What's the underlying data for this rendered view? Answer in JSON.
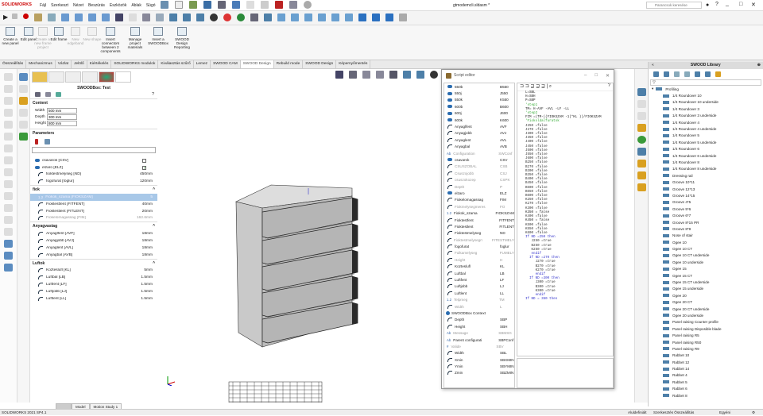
{
  "app": {
    "logo": "SOLIDWORKS",
    "title": "gtmodemcli.sldasm *",
    "search_placeholder": "Parancsok keresése"
  },
  "menu": [
    "Fájl",
    "Szerkeszt",
    "Nézet",
    "Beszúrás",
    "Eszközök",
    "Ablak",
    "Súgó"
  ],
  "ribbon": [
    {
      "label": "Create a new panel",
      "disabled": false
    },
    {
      "label": "Edit panel",
      "disabled": false
    },
    {
      "label": "Create a new frame project",
      "disabled": true
    },
    {
      "label": "Edit frame",
      "disabled": false
    },
    {
      "label": "New edgeband",
      "disabled": true
    },
    {
      "label": "New shape",
      "disabled": true
    },
    {
      "label": "Insert connectors between 2 components",
      "disabled": false
    },
    {
      "label": "Manage project materials",
      "disabled": false
    },
    {
      "label": "Insert a SWOODBox",
      "disabled": false
    },
    {
      "label": "SWOOD Design Reporting",
      "disabled": false
    }
  ],
  "tabs": [
    "Összeállítás",
    "Mechanizmus",
    "Vázlat",
    "Jelölő",
    "Kiértékelés",
    "SOLIDWORKS modulok",
    "Kiválasztás szűrő",
    "Lemez",
    "SWOOD CAM",
    "SWOOD Design",
    "Rebuild mode",
    "SWOOD Design",
    "Képernyőmentés"
  ],
  "active_tab": 9,
  "panel": {
    "title": "SWOODBox: Test",
    "content_label": "Content",
    "fields": [
      {
        "label": "Width",
        "value": "500 mm"
      },
      {
        "label": "Depth",
        "value": "300 mm"
      },
      {
        "label": "Height",
        "value": "800 mm"
      }
    ],
    "parameters_label": "Parameters",
    "params": [
      {
        "label": "csavarok [CSV]",
        "value": "",
        "type": "check",
        "checked": false
      },
      {
        "label": "elzaro [ELZ]",
        "value": "",
        "type": "check",
        "checked": true
      },
      {
        "label": "fioktestmelyseg [ND]",
        "value": "450mm",
        "type": "dim"
      },
      {
        "label": "fogofurat [foglur]",
        "value": "120mm",
        "type": "dim"
      }
    ],
    "groups": [
      {
        "name": "fiok",
        "rows": [
          {
            "label": "Fiokok_szama [FIOKSZAM]",
            "value": "5",
            "sel": true,
            "type": "num"
          },
          {
            "label": "Fioktestfent [FITFENT]",
            "value": "40mm"
          },
          {
            "label": "Fioktestlent [FITLENT]",
            "value": "20mm"
          },
          {
            "label": "Fiokelomagassag [FIM]",
            "value": "162.6mm",
            "grey": true
          }
        ]
      },
      {
        "name": "Anyagvastag",
        "rows": [
          {
            "label": "Anyaglfent [AVF]",
            "value": "18mm"
          },
          {
            "label": "Anyagjobb [AVJ]",
            "value": "18mm"
          },
          {
            "label": "Anyaglent [AVL]",
            "value": "18mm"
          },
          {
            "label": "Anyagbal [AVB]",
            "value": "18mm"
          }
        ]
      },
      {
        "name": "Luftok",
        "rows": [
          {
            "label": "Kozteslufl [KL]",
            "value": "5mm"
          },
          {
            "label": "Luftbal [LB]",
            "value": "1.5mm"
          },
          {
            "label": "Luftfent [LF]",
            "value": "1.5mm"
          },
          {
            "label": "Luftjobb [LJ]",
            "value": "1.5mm"
          },
          {
            "label": "Luftlent [LL]",
            "value": "1.5mm"
          }
        ]
      }
    ]
  },
  "script_editor": {
    "title": "Script editor",
    "vars": [
      [
        "550b",
        "B550",
        0,
        "t"
      ],
      [
        "550j",
        "J550",
        0,
        "t"
      ],
      [
        "550k",
        "K550",
        0,
        "t"
      ],
      [
        "600b",
        "B600",
        0,
        "t"
      ],
      [
        "600j",
        "J600",
        0,
        "t"
      ],
      [
        "600k",
        "K600",
        0,
        "t"
      ],
      [
        "Anyaglfent",
        "AVF",
        0,
        "d"
      ],
      [
        "Anyagjobb",
        "AVJ",
        0,
        "d"
      ],
      [
        "Anyaglent",
        "AVL",
        0,
        "d"
      ],
      [
        "Anyagbal",
        "AVB",
        0,
        "d"
      ],
      [
        "Configuration",
        "SWConf",
        1,
        "a"
      ],
      [
        "csavarok",
        "CSV",
        0,
        "t"
      ],
      [
        "CSUSZOBAL",
        "CSB",
        1,
        "d"
      ],
      [
        "Csuszojobb",
        "CSJ",
        1,
        "d"
      ],
      [
        "csuszokozep",
        "CSPK",
        1,
        "d"
      ],
      [
        "Depth",
        "P",
        1,
        "d"
      ],
      [
        "elzaro",
        "ELZ",
        0,
        "t"
      ],
      [
        "Fiokelomagassag",
        "FIM",
        0,
        "d"
      ],
      [
        "Fiokmelysegmeres",
        "FO",
        1,
        "d"
      ],
      [
        "Fiokok_szama",
        "FIOKSZAM",
        0,
        "n"
      ],
      [
        "Fioktestfent",
        "FITFENT",
        0,
        "d"
      ],
      [
        "Fioktestlent",
        "FITLENT",
        0,
        "d"
      ],
      [
        "Fioktestmelyseg",
        "ND",
        0,
        "d"
      ],
      [
        "Fioktestmelysegmeres",
        "FITESTMELY",
        1,
        "d"
      ],
      [
        "fogofurat",
        "foglur",
        0,
        "d"
      ],
      [
        "Fulkamelyseg",
        "FUMELY",
        1,
        "d"
      ],
      [
        "Height",
        "H",
        1,
        "d"
      ],
      [
        "Kozteslufl",
        "KL",
        0,
        "d"
      ],
      [
        "Luftbal",
        "LB",
        0,
        "d"
      ],
      [
        "Luftfent",
        "LF",
        0,
        "d"
      ],
      [
        "Luftjobb",
        "LJ",
        0,
        "d"
      ],
      [
        "Luftlent",
        "LL",
        0,
        "d"
      ],
      [
        "Telpmeg",
        "TM",
        1,
        "n"
      ],
      [
        "Width",
        "L",
        1,
        "d"
      ],
      [
        "SWOODBox Context",
        "",
        0,
        "g"
      ],
      [
        "Depth",
        "SBP",
        0,
        "d"
      ],
      [
        "Height",
        "SBH",
        0,
        "d"
      ],
      [
        "Message",
        "SBMSG",
        1,
        "a"
      ],
      [
        "Parent configurati",
        "SBPConf",
        0,
        "a"
      ],
      [
        "Valide",
        "SBV",
        1,
        "h"
      ],
      [
        "Width",
        "SBL",
        0,
        "d"
      ],
      [
        "Xmin",
        "SBXMIN",
        0,
        "d"
      ],
      [
        "Ymin",
        "SBYMIN",
        0,
        "d"
      ],
      [
        "Zmin",
        "SBZMIN",
        0,
        "d"
      ]
    ],
    "code": [
      "L=SBL",
      "H=SBH",
      "P=SBP",
      "",
      "'step1",
      "",
      "TM= H-AVF -AVL -LF -LL",
      "",
      "'step2",
      "",
      "FIM =(TM-((FIOKSZAM -1)*KL ))/FIOKSZAM",
      "",
      "'Fiokoldalfuratok",
      "",
      "J250 =false",
      "J270 =false",
      "J300 =false",
      "J350 =false",
      "J400 =false",
      "J450 =false",
      "J500 =false",
      "J550 =false",
      "J600 =false",
      "B250 =false",
      "B270 =false",
      "B300 =false",
      "B350 =false",
      "B400 =false",
      "B450 =false",
      "B500 =false",
      "B550 =false",
      "B600 =false",
      "K250 =false",
      "K270 =false",
      "K300 =false",
      "K350 = false",
      "K400 =false",
      "K450 = false",
      "K500 =false",
      "K550 =false",
      "K600 =false",
      "",
      "If ND =250 then",
      "",
      "   J250 =true",
      "   B250 =true",
      "   K250 =true",
      "",
      "   endif",
      "",
      "  If ND =270 then",
      "",
      "     J270 =true",
      "     B270 =true",
      "     K270 =true",
      "",
      "     endif",
      "",
      "  If ND =300 then",
      "     J300 =true",
      "     B300 =true",
      "     K300 =true",
      "",
      "     endif",
      "",
      "If ND = 350 then"
    ]
  },
  "library": {
    "title": "SWOOD Library",
    "root": "Profiling",
    "items": [
      "1/4 Roundover 10",
      "1/4 Roundover 10 underside",
      "1/4 Roundover 3",
      "1/4 Roundover 3 underside",
      "1/4 Roundover 4",
      "1/4 Roundover 4 underside",
      "1/4 Roundover 5",
      "1/4 Roundover 5 underside",
      "1/4 Roundover 6",
      "1/4 Roundover 6 underside",
      "1/4 Roundover 8",
      "1/4 Roundover 8 underside",
      "Dressing rail",
      "Groove 10*11",
      "Groove 12*13",
      "Groove 14*15",
      "Groove 4*5",
      "Groove 5*6",
      "Groove 6*7",
      "Groove 8*15 PR",
      "Groove 8*9",
      "Nose of stair",
      "Ogee 10",
      "Ogee 10 CT",
      "Ogee 10 CT underside",
      "Ogee 10 underside",
      "Ogee 15",
      "Ogee 15 CT",
      "Ogee 15 CT underside",
      "Ogee 15 underside",
      "Ogee 20",
      "Ogee 20 CT",
      "Ogee 20 CT underside",
      "Ogee 20 underside",
      "Panel raising Counter profile",
      "Panel raising Disposible blade",
      "Panel raising R5",
      "Panel raising R50",
      "Panel raising R9",
      "Rabbet 10",
      "Rabbet 12",
      "Rabbet 14",
      "Rabbet 4",
      "Rabbet 5",
      "Rabbet 6",
      "Rabbet 8"
    ]
  },
  "bottom_tabs": [
    "Model",
    "Motion Study 1"
  ],
  "status": {
    "left": "SOLIDWORKS 2021 SP4.1",
    "middle": "Aluldefiniált",
    "mode": "Szerkesztés Összeállítás",
    "units": "Egyéni"
  }
}
